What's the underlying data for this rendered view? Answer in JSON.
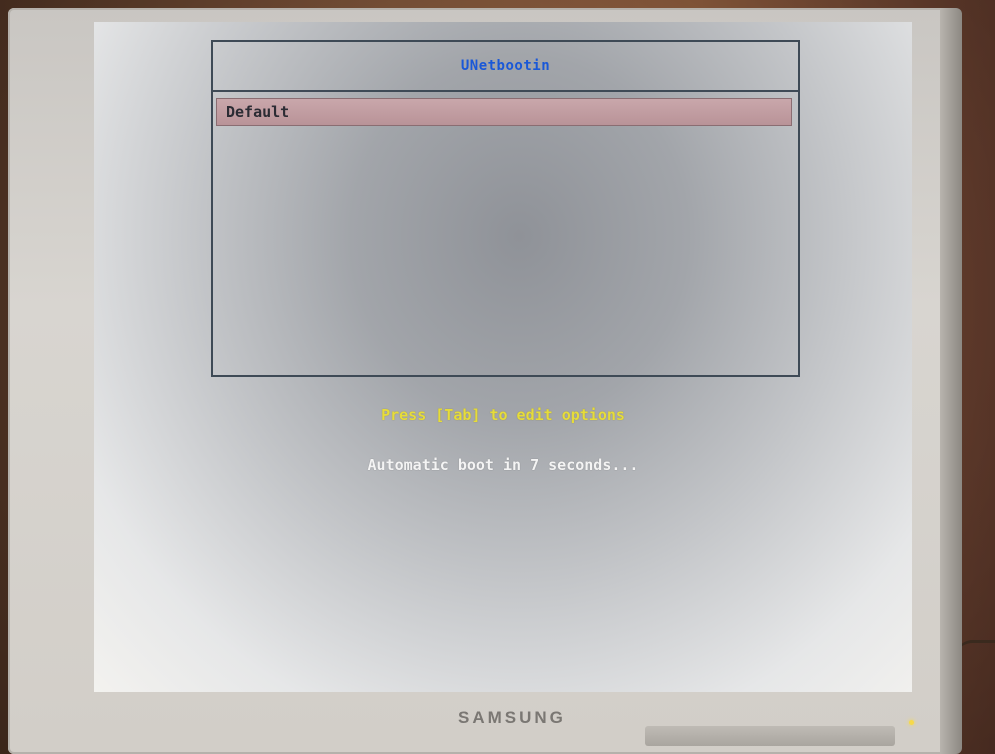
{
  "bootloader": {
    "title": "UNetbootin",
    "menu_items": [
      {
        "label": "Default",
        "selected": true
      }
    ],
    "hint": "Press [Tab] to edit options",
    "countdown": "Automatic boot in 7 seconds..."
  },
  "monitor": {
    "brand": "SAMSUNG"
  },
  "colors": {
    "title": "#1a58d8",
    "hint": "#e6dc3a",
    "countdown": "#f4f4f4",
    "selection": "#c09ba0",
    "border": "#3e4a56"
  }
}
